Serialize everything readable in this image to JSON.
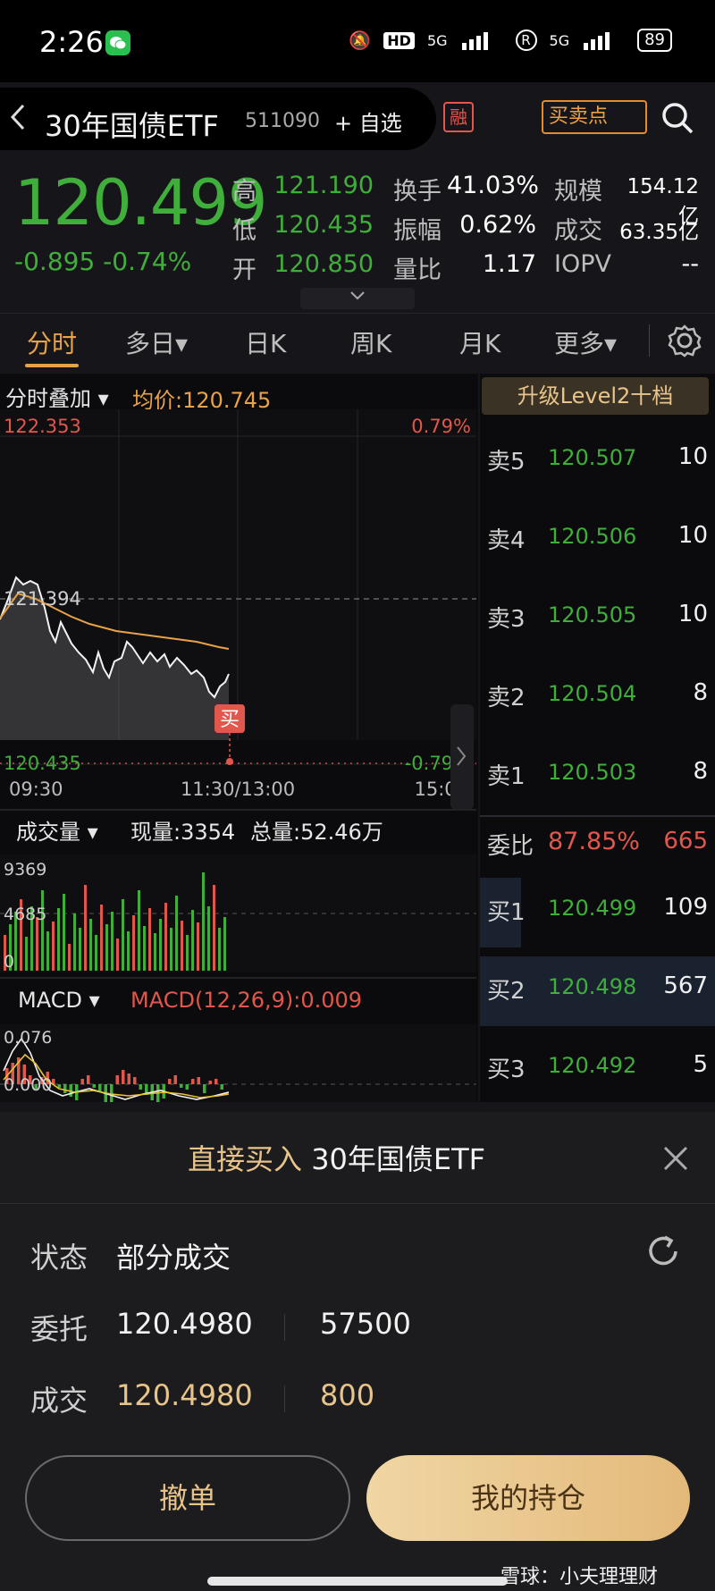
{
  "status_bar": {
    "time": "2:26",
    "hd": "HD",
    "net1": "5G",
    "r": "R",
    "net2": "5G",
    "battery": "89"
  },
  "header": {
    "back": "<",
    "title": "30年国债ETF",
    "code": "511090",
    "add_watch": "+ 自选",
    "rong": "融",
    "buy_sell_point": "买卖点"
  },
  "quote": {
    "price": "120.499",
    "change": "-0.895 -0.74%",
    "high_label": "高",
    "high": "121.190",
    "low_label": "低",
    "low": "120.435",
    "open_label": "开",
    "open": "120.850",
    "turnover_label": "换手",
    "turnover": "41.03%",
    "amplitude_label": "振幅",
    "amplitude": "0.62%",
    "volume_ratio_label": "量比",
    "volume_ratio": "1.17",
    "scale_label": "规模",
    "scale": "154.12亿",
    "amount_label": "成交",
    "amount": "63.35亿",
    "iopv_label": "IOPV",
    "iopv": "--"
  },
  "tabs": [
    {
      "label": "分时"
    },
    {
      "label": "多日▾"
    },
    {
      "label": "日K"
    },
    {
      "label": "周K"
    },
    {
      "label": "月K"
    },
    {
      "label": "更多▾"
    }
  ],
  "intraday": {
    "overlay_label": "分时叠加 ▾",
    "avg_price": "均价:120.745",
    "y_top": "122.353",
    "y_mid": "121.394",
    "y_bottom": "120.435",
    "pct_top": "0.79%",
    "pct_bottom": "-0.79%",
    "time_start": "09:30",
    "time_mid": "11:30/13:00",
    "time_end": "15:00",
    "buy_marker": "买",
    "volume_label": "成交量 ▾",
    "current_vol": "现量:3354",
    "total_vol": "总量:52.46万",
    "vol_top": "9369",
    "vol_mid": "4685",
    "vol_zero": "0",
    "macd_label": "MACD ▾",
    "macd_value": "MACD(12,26,9):0.009",
    "macd_top": "0.076",
    "macd_mid": "0.000",
    "colors": {
      "price_line": "#f2f2f2",
      "avg_line": "#e8a248",
      "up": "#e2574c",
      "down": "#3fae3a"
    }
  },
  "order_book": {
    "level2_button": "升级Level2十档",
    "asks": [
      {
        "label": "卖5",
        "price": "120.507",
        "vol": "10"
      },
      {
        "label": "卖4",
        "price": "120.506",
        "vol": "10"
      },
      {
        "label": "卖3",
        "price": "120.505",
        "vol": "10"
      },
      {
        "label": "卖2",
        "price": "120.504",
        "vol": "8"
      },
      {
        "label": "卖1",
        "price": "120.503",
        "vol": "8"
      }
    ],
    "commission_ratio_label": "委比",
    "commission_ratio": "87.85%",
    "commission_diff": "665",
    "bids": [
      {
        "label": "买1",
        "price": "120.499",
        "vol": "109"
      },
      {
        "label": "买2",
        "price": "120.498",
        "vol": "567"
      },
      {
        "label": "买3",
        "price": "120.492",
        "vol": "5"
      }
    ]
  },
  "sheet": {
    "title_action": "直接买入",
    "title_name": "30年国债ETF",
    "status_label": "状态",
    "status_value": "部分成交",
    "order_label": "委托",
    "order_price": "120.4980",
    "order_qty": "57500",
    "fill_label": "成交",
    "fill_price": "120.4980",
    "fill_qty": "800",
    "cancel_button": "撤单",
    "position_button": "我的持仓",
    "watermark": "雪球：小夫理理财"
  }
}
